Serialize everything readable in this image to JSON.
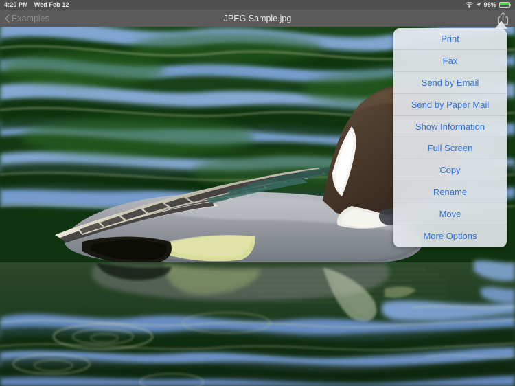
{
  "status_bar": {
    "time": "4:20 PM",
    "date": "Wed Feb 12",
    "wifi_icon": "wifi-icon",
    "location_icon": "location-arrow-icon",
    "battery_percent": "98%",
    "battery_level": 98,
    "battery_icon": "battery-charging-icon",
    "battery_color": "#4cd447"
  },
  "nav_bar": {
    "back_label": "Examples",
    "back_icon": "chevron-left-icon",
    "title": "JPEG Sample.jpg",
    "share_icon": "share-icon",
    "background_color": "#5a5a5a",
    "title_color": "#e8e8e8",
    "back_color": "#8d8d8d"
  },
  "popover": {
    "accent_color": "#2f72d8",
    "arrow_icon": "popover-arrow-up-icon",
    "items": [
      {
        "label": "Print",
        "name": "menu-item-print"
      },
      {
        "label": "Fax",
        "name": "menu-item-fax"
      },
      {
        "label": "Send by Email",
        "name": "menu-item-send-by-email"
      },
      {
        "label": "Send by Paper Mail",
        "name": "menu-item-send-by-paper-mail"
      },
      {
        "label": "Show Information",
        "name": "menu-item-show-information"
      },
      {
        "label": "Full Screen",
        "name": "menu-item-full-screen"
      },
      {
        "label": "Copy",
        "name": "menu-item-copy"
      },
      {
        "label": "Rename",
        "name": "menu-item-rename"
      },
      {
        "label": "Move",
        "name": "menu-item-move"
      },
      {
        "label": "More Options",
        "name": "menu-item-more-options"
      }
    ]
  },
  "photo": {
    "subject": "Northern Pintail duck floating on rippled green and blue water",
    "water_green": "#153a13",
    "water_blue": "#7ba3dd",
    "duck_head": "#4a3a2c",
    "duck_body": "#8e9298",
    "duck_flank_yellow": "#d7dc9a"
  }
}
